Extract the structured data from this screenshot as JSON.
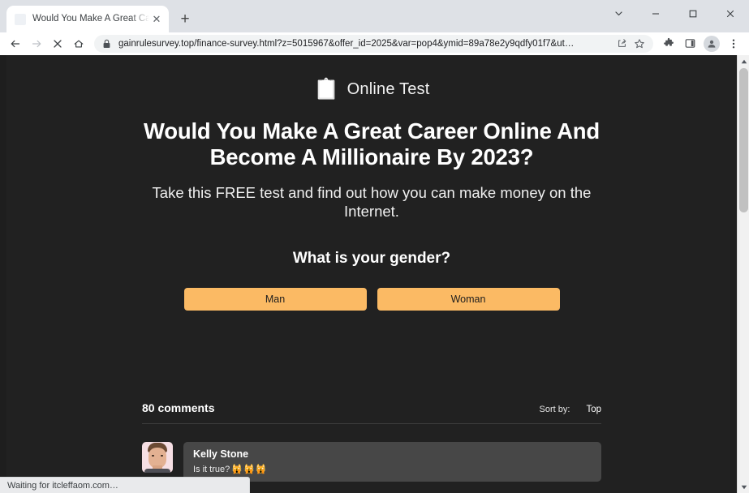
{
  "browser": {
    "tab": {
      "title": "Would You Make A Great Career",
      "favicon_name": "page-favicon",
      "close_glyph": "✕"
    },
    "newtab_glyph": "+",
    "window_controls": {
      "tab_search_name": "tab-search-chevron-down-icon",
      "minimize_name": "minimize-icon",
      "maximize_name": "maximize-icon",
      "close_name": "close-icon"
    },
    "toolbar": {
      "back_name": "back-arrow-icon",
      "forward_name": "forward-arrow-icon",
      "stop_name": "stop-loading-x-icon",
      "home_name": "home-icon",
      "lock_name": "lock-icon",
      "url": "gainrulesurvey.top/finance-survey.html?z=5015967&offer_id=2025&var=pop4&ymid=89a78e2y9qdfy01f7&ut…",
      "share_name": "share-icon",
      "bookmark_name": "bookmark-star-icon",
      "extensions_name": "extensions-puzzle-icon",
      "sidepanel_name": "side-panel-icon",
      "profile_name": "profile-avatar-icon",
      "menu_name": "three-dot-menu-icon"
    },
    "status_text": "Waiting for itcleffaom.com…",
    "scrollbar": {
      "up_glyph": "▲",
      "down_glyph": "▼"
    }
  },
  "page": {
    "brand": {
      "icon": "📋",
      "icon_name": "clipboard-checklist-icon",
      "name": "Online Test"
    },
    "headline": "Would You Make A Great Career Online And Become A Millionaire By 2023?",
    "subhead": "Take this FREE test and find out how you can make money on the Internet.",
    "question": "What is your gender?",
    "answers": [
      {
        "label": "Man"
      },
      {
        "label": "Woman"
      }
    ],
    "comments": {
      "count_label": "80 comments",
      "sort_label": "Sort by:",
      "sort_value": "Top",
      "items": [
        {
          "author": "Kelly Stone",
          "text": "Is it true?",
          "emoji": "🙀🙀🙀"
        }
      ]
    }
  },
  "colors": {
    "page_bg": "#212121",
    "answer_button": "#fbba64",
    "answer_button_text": "#1d1d1d",
    "comment_bg": "#474747",
    "divider": "#3d3d3d"
  }
}
